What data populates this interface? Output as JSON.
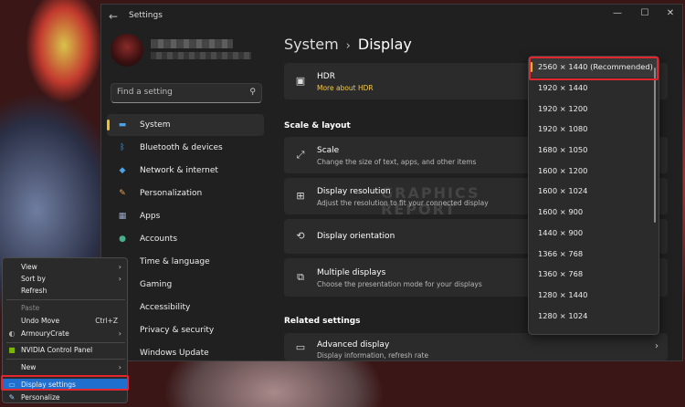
{
  "window": {
    "app_title": "Settings",
    "back_glyph": "←",
    "minimize_glyph": "—",
    "maximize_glyph": "☐",
    "close_glyph": "✕"
  },
  "search": {
    "placeholder": "Find a setting",
    "icon": "search-icon"
  },
  "sidebar": {
    "items": [
      {
        "label": "System",
        "icon": "monitor-icon",
        "color": "#4aa3e8"
      },
      {
        "label": "Bluetooth & devices",
        "icon": "bluetooth-icon",
        "color": "#4aa3e8"
      },
      {
        "label": "Network & internet",
        "icon": "wifi-icon",
        "color": "#4aa3e8"
      },
      {
        "label": "Personalization",
        "icon": "brush-icon",
        "color": "#e8a24a"
      },
      {
        "label": "Apps",
        "icon": "apps-icon",
        "color": "#9aa9c8"
      },
      {
        "label": "Accounts",
        "icon": "person-icon",
        "color": "#48b08a"
      },
      {
        "label": "Time & language",
        "icon": "globe-clock-icon",
        "color": "#4aa3e8"
      },
      {
        "label": "Gaming",
        "icon": "gamepad-icon",
        "color": "#9aa9c8"
      },
      {
        "label": "Accessibility",
        "icon": "accessibility-icon",
        "color": "#4aa3e8"
      },
      {
        "label": "Privacy & security",
        "icon": "shield-icon",
        "color": "#9aa9c8"
      },
      {
        "label": "Windows Update",
        "icon": "update-icon",
        "color": "#4aa3e8"
      }
    ]
  },
  "main": {
    "breadcrumb_parent": "System",
    "breadcrumb_sep": "›",
    "breadcrumb_current": "Display",
    "hdr": {
      "title": "HDR",
      "link": "More about HDR"
    },
    "section_scale": "Scale & layout",
    "scale": {
      "title": "Scale",
      "subtitle": "Change the size of text, apps, and other items"
    },
    "resolution": {
      "title": "Display resolution",
      "subtitle": "Adjust the resolution to fit your connected display"
    },
    "orientation": {
      "title": "Display orientation"
    },
    "multiple": {
      "title": "Multiple displays",
      "subtitle": "Choose the presentation mode for your displays"
    },
    "section_related": "Related settings",
    "advanced": {
      "title": "Advanced display",
      "subtitle": "Display information, refresh rate"
    },
    "chevron": "›"
  },
  "resolution_dropdown": {
    "selected_index": 0,
    "options": [
      "2560 × 1440 (Recommended)",
      "1920 × 1440",
      "1920 × 1200",
      "1920 × 1080",
      "1680 × 1050",
      "1600 × 1200",
      "1600 × 1024",
      "1600 × 900",
      "1440 × 900",
      "1366 × 768",
      "1360 × 768",
      "1280 × 1440",
      "1280 × 1024"
    ]
  },
  "watermark": {
    "line1": "GRAPHICS",
    "line2": "REPORT"
  },
  "context_menu": {
    "view": "View",
    "sort_by": "Sort by",
    "refresh": "Refresh",
    "paste": "Paste",
    "undo_move": "Undo Move",
    "undo_shortcut": "Ctrl+Z",
    "armoury": "ArmouryCrate",
    "nvidia": "NVIDIA Control Panel",
    "new": "New",
    "display_settings": "Display settings",
    "personalize": "Personalize",
    "submenu_arrow": "›"
  },
  "colors": {
    "accent": "#f0c02a",
    "highlight_border": "#e0262f",
    "menu_highlight": "#1e6fce"
  }
}
